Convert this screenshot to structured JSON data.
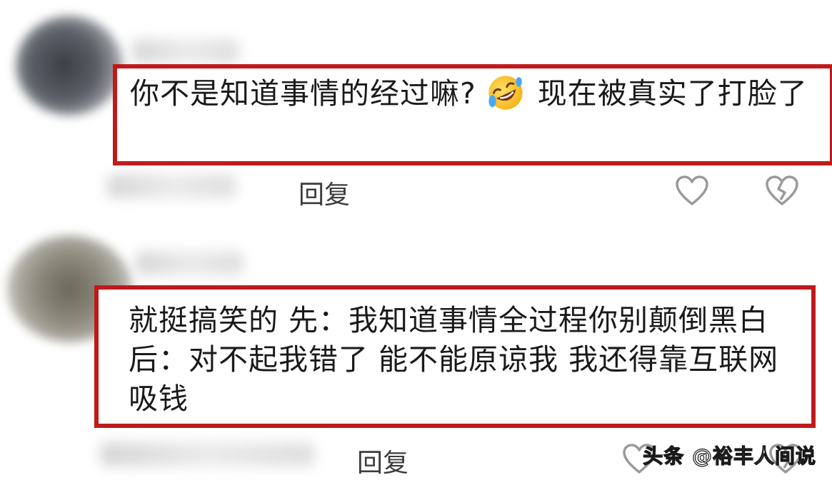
{
  "comments": [
    {
      "text_part1": "你不是知道事情的经过嘛?",
      "emoji": "rolling-on-floor-laughing-emoji",
      "text_part2": "现在被真实了打脸了",
      "reply_label": "回复"
    },
    {
      "text": "就挺搞笑的 先：我知道事情全过程你别颠倒黑白 后：对不起我错了 能不能原谅我 我还得靠互联网吸钱",
      "reply_label": "回复"
    }
  ],
  "watermark": "头条 @裕丰人间说",
  "colors": {
    "highlight_border": "#c0191b",
    "text": "#1a1a1a",
    "icon": "#9a9a9a"
  },
  "icons": [
    "heart-outline-icon",
    "broken-heart-icon"
  ]
}
